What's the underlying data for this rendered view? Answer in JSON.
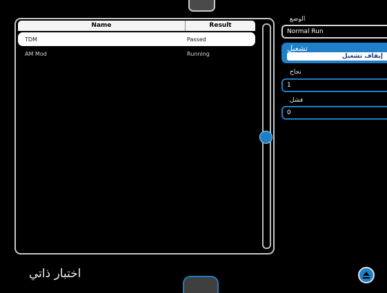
{
  "table": {
    "headers": {
      "name": "Name",
      "result": "Result"
    },
    "rows": [
      {
        "name": "TDM",
        "result": "Passed",
        "selected": true
      },
      {
        "name": "AM Mod",
        "result": "Running",
        "selected": false
      }
    ]
  },
  "controls": {
    "mode_label": "الوضع",
    "mode_value": "Normal Run",
    "run_label": "تشغيل",
    "stop_label": "إيقاف تشغيل",
    "pass_label": "نجاح",
    "pass_value": "1",
    "fail_label": "فشل",
    "fail_value": "0"
  },
  "page": {
    "title": "اختبار ذاتي"
  },
  "icons": {
    "collapse": "eject-up-icon"
  },
  "colors": {
    "accent": "#1f7fc8",
    "background": "#000000",
    "selected_row": "#ffffff"
  }
}
